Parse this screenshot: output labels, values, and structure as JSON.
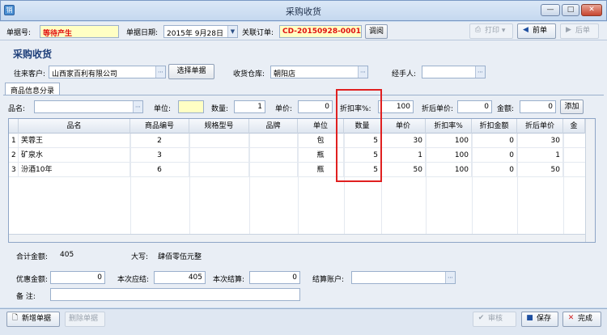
{
  "window": {
    "title": "采购收货",
    "icon": "app-icon",
    "minimize_label": "—",
    "maximize_label": "□",
    "close_label": "✕"
  },
  "toolbar": {
    "doc_no_label": "单据号:",
    "doc_no_value": "等待产生",
    "doc_date_label": "单据日期:",
    "doc_date_value": "2015年 9月28日",
    "related_order_label": "关联订单:",
    "related_order_value": "CD-20150928-0001",
    "lookup_button": "调阅",
    "print_button": "打印",
    "prev_button": "前单",
    "next_button": "后单"
  },
  "header": {
    "section_title": "采购收货",
    "supplier_label": "往来客户:",
    "supplier_value": "山西家百利有限公司",
    "select_doc_button": "选择单据",
    "warehouse_label": "收货仓库:",
    "warehouse_value": "朝阳店",
    "handler_label": "经手人:",
    "handler_value": ""
  },
  "tab": {
    "label": "商品信息分录"
  },
  "entry": {
    "name_label": "品名:",
    "name_value": "",
    "unit_label": "单位:",
    "unit_value": "",
    "qty_label": "数量:",
    "qty_value": "1",
    "price_label": "单价:",
    "price_value": "0",
    "discount_label": "折扣率%:",
    "discount_value": "100",
    "disc_price_label": "折后单价:",
    "disc_price_value": "0",
    "amount_label": "金额:",
    "amount_value": "0",
    "add_button": "添加"
  },
  "grid": {
    "columns": [
      "品名",
      "商品编号",
      "规格型号",
      "品牌",
      "单位",
      "数量",
      "单价",
      "折扣率%",
      "折扣金额",
      "折后单价",
      "金"
    ],
    "rows": [
      {
        "no": "1",
        "cells": [
          "芙蓉王",
          "2",
          "",
          "",
          "包",
          "5",
          "30",
          "100",
          "0",
          "30"
        ]
      },
      {
        "no": "2",
        "cells": [
          "矿泉水",
          "3",
          "",
          "",
          "瓶",
          "5",
          "1",
          "100",
          "0",
          "1"
        ]
      },
      {
        "no": "3",
        "cells": [
          "汾酒10年",
          "6",
          "",
          "",
          "瓶",
          "5",
          "50",
          "100",
          "0",
          "50"
        ]
      }
    ]
  },
  "totals": {
    "total_label": "合计金额:",
    "total_value": "405",
    "capital_label": "大写:",
    "capital_value": "肆佰零伍元整"
  },
  "payment": {
    "discount_amount_label": "优惠金额:",
    "discount_amount_value": "0",
    "payable_label": "本次应结:",
    "payable_value": "405",
    "settled_label": "本次结算:",
    "settled_value": "0",
    "account_label": "结算账户:",
    "account_value": "",
    "remark_label": "备    注:",
    "remark_value": ""
  },
  "bottom": {
    "new_doc_button": "新增单据",
    "delete_doc_button": "删除单据",
    "approve_button": "审核",
    "save_button": "保存",
    "finish_button": "完成"
  },
  "colors": {
    "accent": "#1e3f7a",
    "highlight_box": "#e02020",
    "doc_no_text": "#e01010"
  }
}
